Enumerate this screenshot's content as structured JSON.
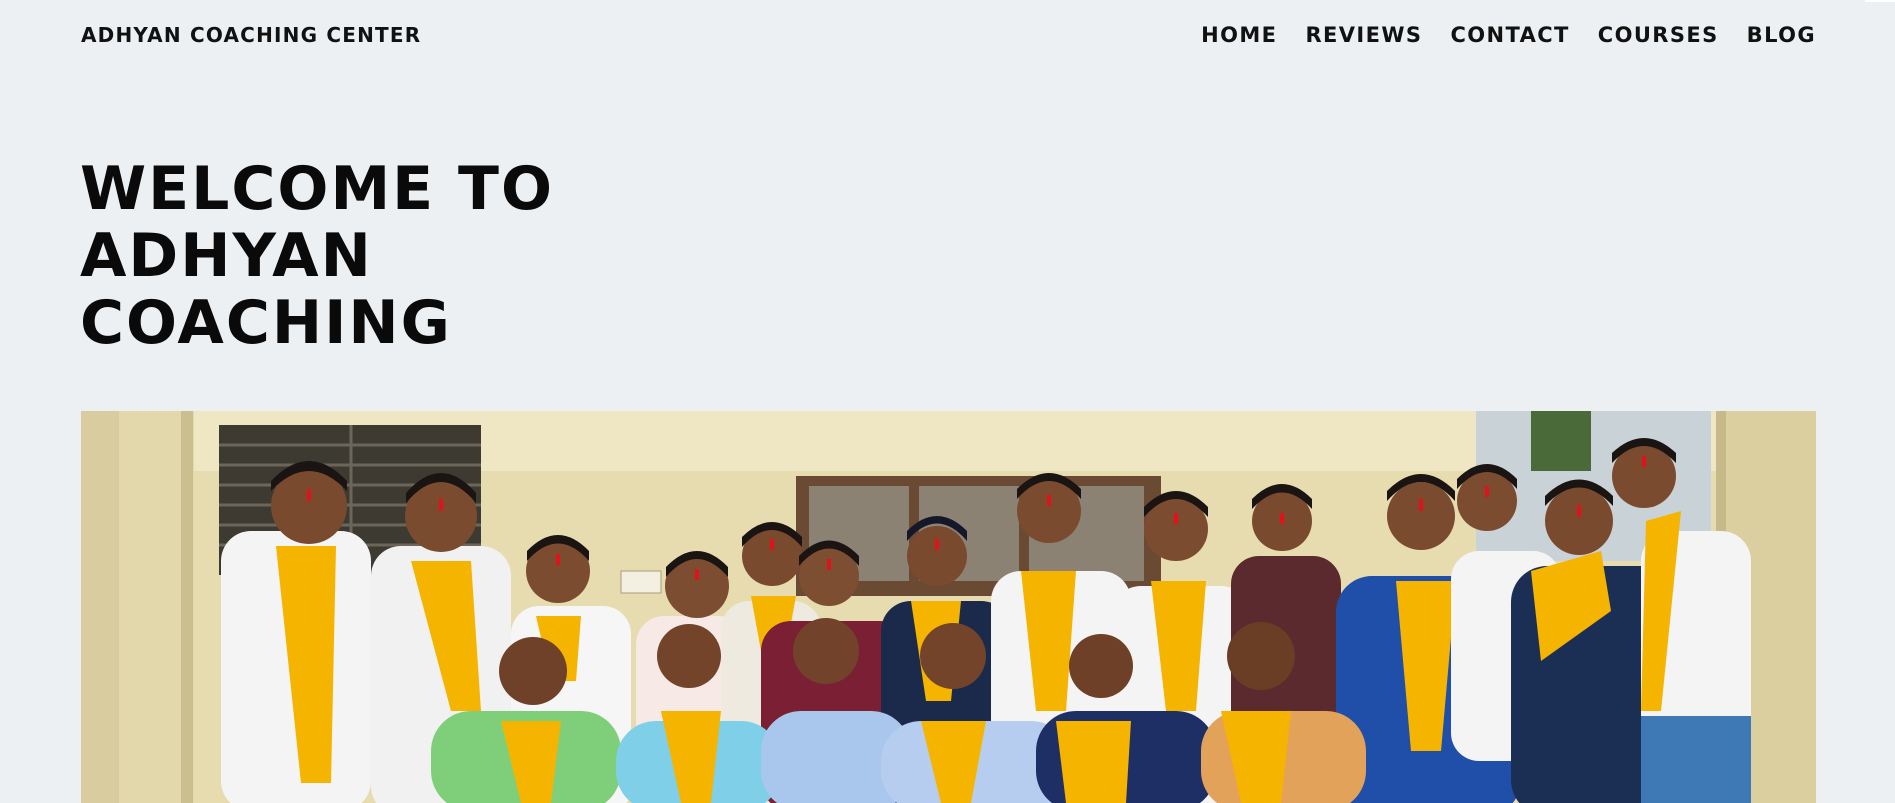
{
  "header": {
    "brand": "ADHYAN COACHING CENTER",
    "nav": [
      {
        "label": "HOME"
      },
      {
        "label": "REVIEWS"
      },
      {
        "label": "CONTACT"
      },
      {
        "label": "COURSES"
      },
      {
        "label": "BLOG"
      }
    ]
  },
  "hero": {
    "title_lines": [
      "WELCOME TO",
      "ADHYAN",
      "COACHING"
    ]
  },
  "colors": {
    "background": "#edf0f3",
    "text": "#0a0a0a",
    "scarf": "#f5b400",
    "tilak": "#e0121b"
  }
}
